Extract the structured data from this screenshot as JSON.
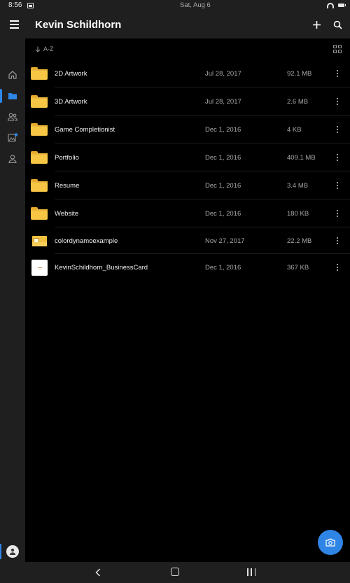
{
  "status_bar": {
    "time": "8:56",
    "date": "Sat, Aug 6"
  },
  "app_bar": {
    "title": "Kevin Schildhorn",
    "icons": [
      "menu-icon",
      "plus-icon",
      "search-icon"
    ]
  },
  "sidebar": {
    "items": [
      {
        "name": "home",
        "icon": "home-icon",
        "active": false
      },
      {
        "name": "files",
        "icon": "folder-icon",
        "active": true
      },
      {
        "name": "shared",
        "icon": "people-icon",
        "active": false
      },
      {
        "name": "photos",
        "icon": "photos-icon",
        "active": false,
        "badge": true
      },
      {
        "name": "me",
        "icon": "person-icon",
        "active": false
      }
    ],
    "account_icon": "avatar-icon"
  },
  "sort_bar": {
    "label": "A-Z",
    "sort_icon": "arrow-down-icon",
    "view_icon": "grid-view-icon"
  },
  "files": [
    {
      "name": "2D Artwork",
      "date": "Jul 28, 2017",
      "size": "92.1 MB",
      "kind": "folder"
    },
    {
      "name": "3D Artwork",
      "date": "Jul 28, 2017",
      "size": "2.6 MB",
      "kind": "folder"
    },
    {
      "name": "Game Completionist",
      "date": "Dec 1, 2016",
      "size": "4 KB",
      "kind": "folder"
    },
    {
      "name": "Portfolio",
      "date": "Dec 1, 2016",
      "size": "409.1 MB",
      "kind": "folder"
    },
    {
      "name": "Resume",
      "date": "Dec 1, 2016",
      "size": "3.4 MB",
      "kind": "folder"
    },
    {
      "name": "Website",
      "date": "Dec 1, 2016",
      "size": "180 KB",
      "kind": "folder"
    },
    {
      "name": "colordynamoexample",
      "date": "Nov 27, 2017",
      "size": "22.2 MB",
      "kind": "archive"
    },
    {
      "name": "KevinSchildhorn_BusinessCard",
      "date": "Dec 1, 2016",
      "size": "367 KB",
      "kind": "image"
    }
  ],
  "fab": {
    "icon": "camera-icon"
  },
  "colors": {
    "accent": "#2f85e6",
    "chrome": "#1f1f1f",
    "background": "#000000",
    "folder": "#f6c644"
  }
}
